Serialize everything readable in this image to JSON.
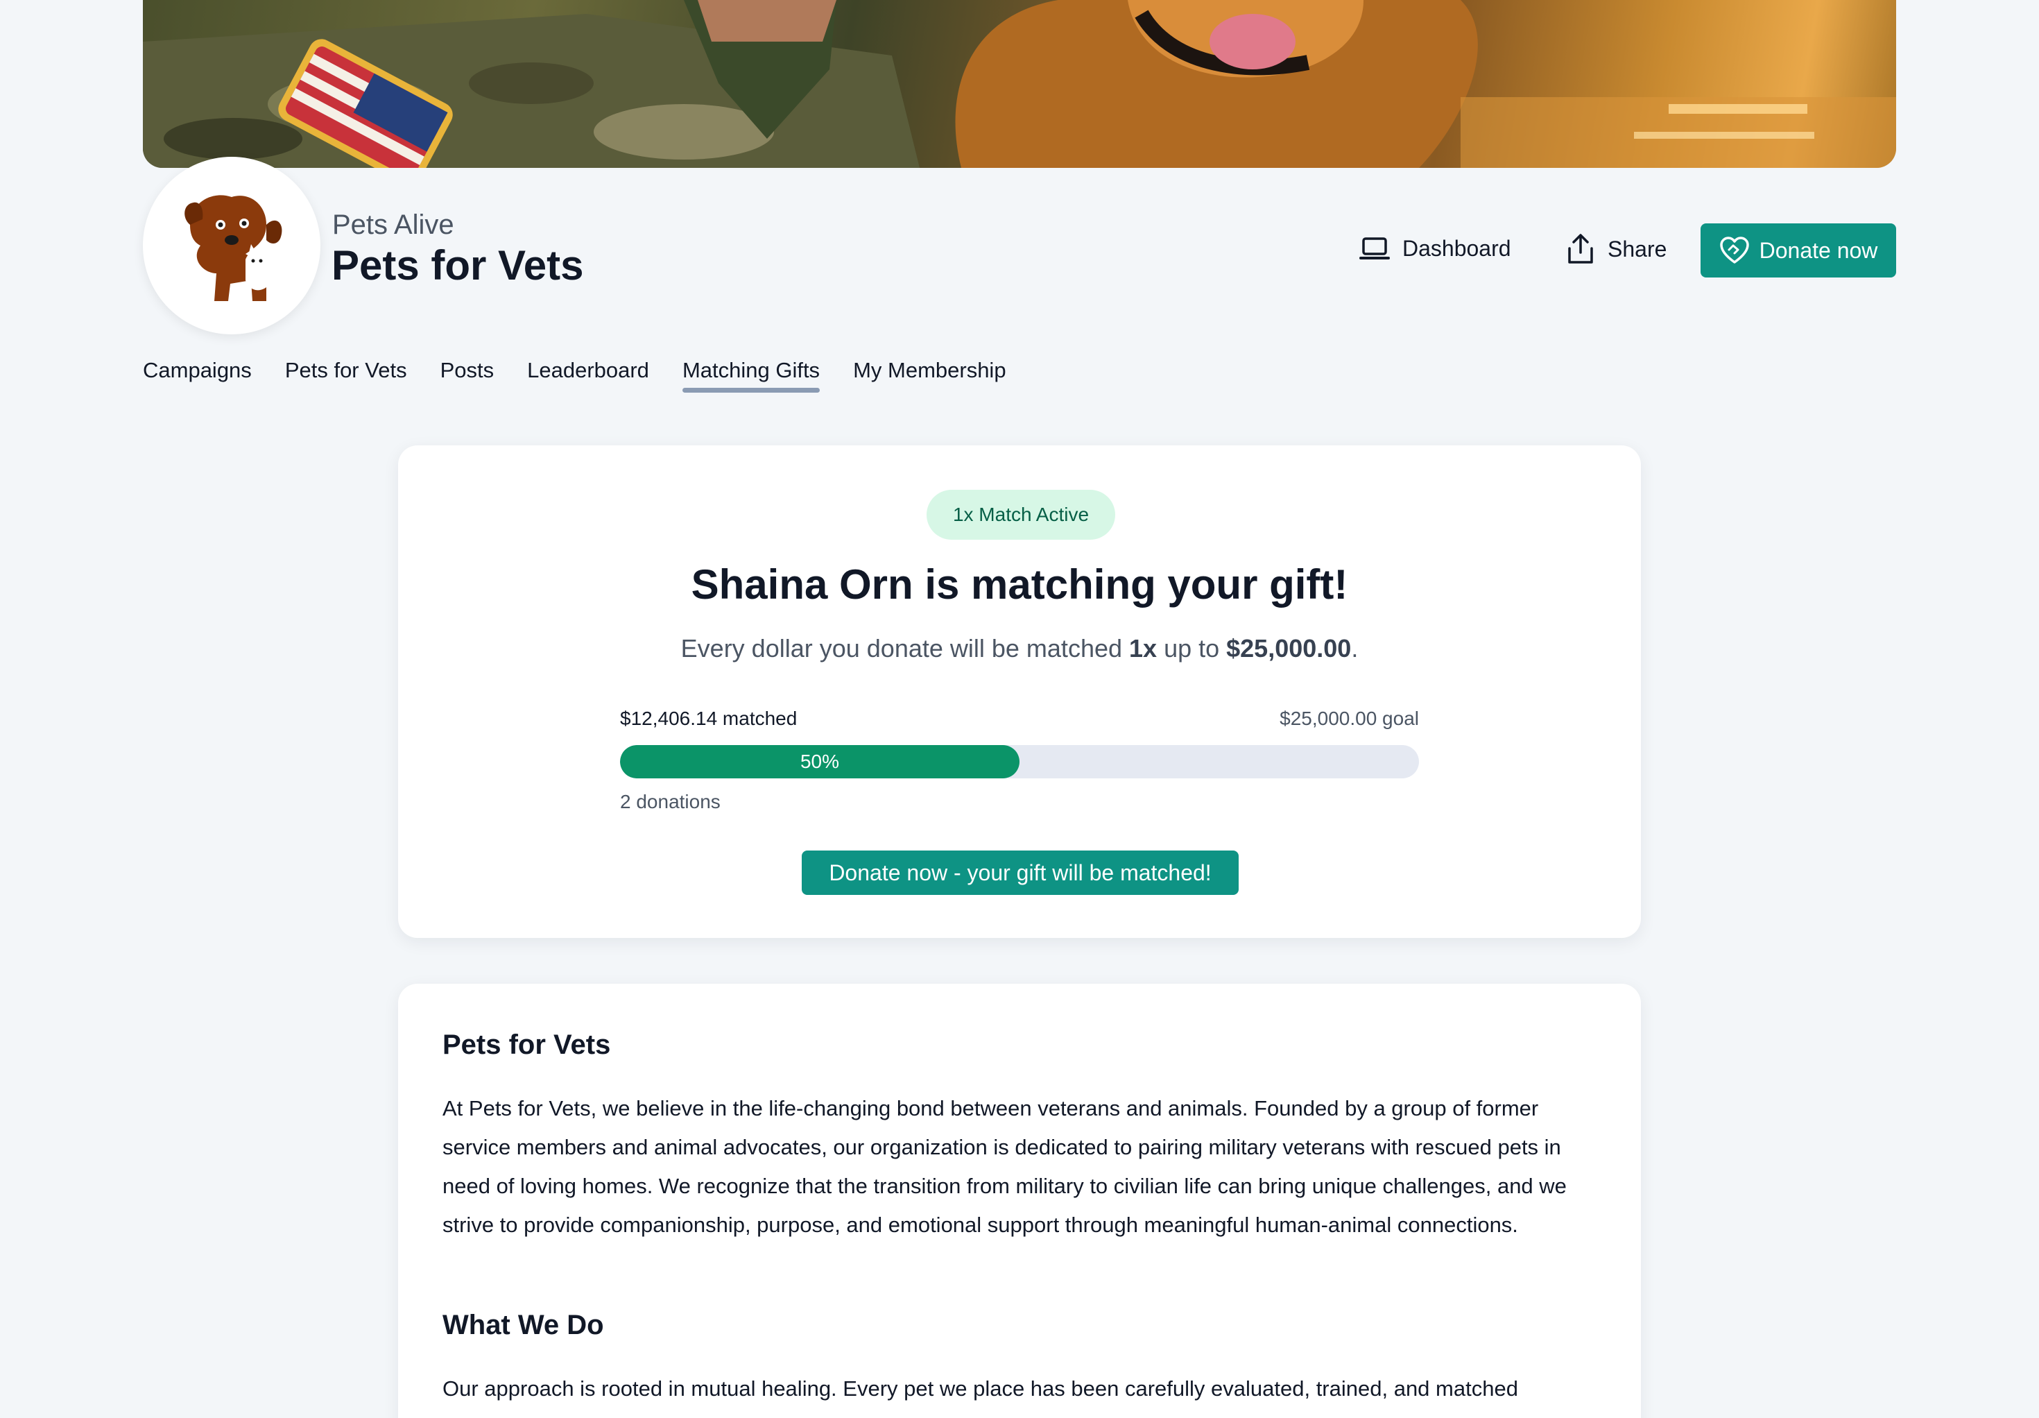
{
  "org": {
    "subtitle": "Pets Alive",
    "title": "Pets for Vets"
  },
  "header_actions": {
    "dashboard_label": "Dashboard",
    "share_label": "Share",
    "donate_label": "Donate now"
  },
  "tabs": [
    {
      "label": "Campaigns",
      "active": false
    },
    {
      "label": "Pets for Vets",
      "active": false
    },
    {
      "label": "Posts",
      "active": false
    },
    {
      "label": "Leaderboard",
      "active": false
    },
    {
      "label": "Matching Gifts",
      "active": true
    },
    {
      "label": "My Membership",
      "active": false
    }
  ],
  "match": {
    "badge": "1x Match Active",
    "title": "Shaina Orn is matching your gift!",
    "desc_prefix": "Every dollar you donate will be matched ",
    "multiplier": "1x",
    "desc_mid": " up to ",
    "cap": "$25,000.00",
    "desc_suffix": ".",
    "matched_label": "$12,406.14 matched",
    "goal_label": "$25,000.00 goal",
    "progress_percent": 50,
    "progress_label": "50%",
    "donations_label": "2 donations",
    "button_label": "Donate now - your gift will be matched!"
  },
  "about": {
    "heading": "Pets for Vets",
    "paragraph": "At Pets for Vets, we believe in the life-changing bond between veterans and animals. Founded by a group of former service members and animal advocates, our organization is dedicated to pairing military veterans with rescued pets in need of loving homes. We recognize that the transition from military to civilian life can bring unique challenges, and we strive to provide companionship, purpose, and emotional support through meaningful human-animal connections.",
    "heading2": "What We Do",
    "paragraph2": "Our approach is rooted in mutual healing. Every pet we place has been carefully evaluated, trained, and matched"
  },
  "colors": {
    "primary": "#0e9384",
    "progress": "#0b9468",
    "badge_bg": "#d7f7e6",
    "page_bg": "#f3f6f9"
  },
  "icons": {
    "dashboard": "laptop-icon",
    "share": "share-icon",
    "donate": "heart-hand-icon",
    "logo": "dog-cat-logo"
  }
}
